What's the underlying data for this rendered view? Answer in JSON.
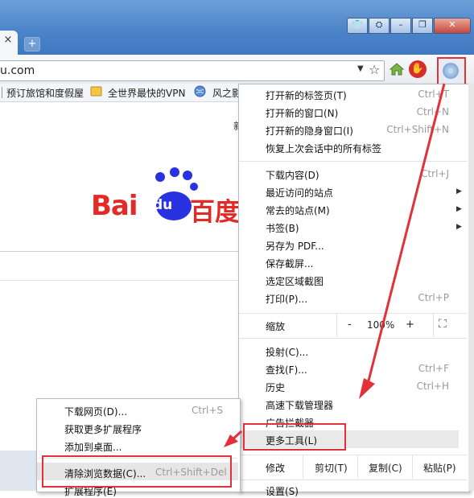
{
  "browser": {
    "tab_close": "×",
    "new_tab": "+",
    "url": "u.com",
    "window_buttons": [
      "👕",
      "⛭",
      "–",
      "❐",
      "✕"
    ]
  },
  "bookmarks": [
    {
      "label": "预订旅馆和度假屋"
    },
    {
      "label": "全世界最快的VPN"
    },
    {
      "label": "风之影"
    }
  ],
  "page": {
    "logo_text": "Bai",
    "logo_du": "du",
    "logo_cn": "百度",
    "side_char": "新"
  },
  "menu": {
    "items": [
      {
        "label": "打开新的标签页(T)",
        "shortcut": "Ctrl+T"
      },
      {
        "label": "打开新的窗口(N)",
        "shortcut": "Ctrl+N"
      },
      {
        "label": "打开新的隐身窗口(I)",
        "shortcut": "Ctrl+Shift+N"
      },
      {
        "label": "恢复上次会话中的所有标签",
        "shortcut": ""
      },
      {
        "label": "下载内容(D)",
        "shortcut": "Ctrl+J"
      },
      {
        "label": "最近访问的站点",
        "shortcut": ""
      },
      {
        "label": "常去的站点(M)",
        "shortcut": ""
      },
      {
        "label": "书签(B)",
        "shortcut": ""
      },
      {
        "label": "另存为 PDF...",
        "shortcut": ""
      },
      {
        "label": "保存截屏...",
        "shortcut": ""
      },
      {
        "label": "选定区域截图",
        "shortcut": ""
      },
      {
        "label": "打印(P)...",
        "shortcut": "Ctrl+P"
      },
      {
        "label": "投射(C)...",
        "shortcut": ""
      },
      {
        "label": "查找(F)...",
        "shortcut": "Ctrl+F"
      },
      {
        "label": "历史",
        "shortcut": "Ctrl+H"
      },
      {
        "label": "高速下载管理器",
        "shortcut": ""
      },
      {
        "label": "广告拦截器",
        "shortcut": ""
      },
      {
        "label": "更多工具(L)",
        "shortcut": ""
      }
    ],
    "zoom": {
      "label": "缩放",
      "minus": "-",
      "value": "100%",
      "plus": "+",
      "fullscreen": "⛶"
    },
    "edit": {
      "label": "修改",
      "cut": "剪切(T)",
      "copy": "复制(C)",
      "paste": "粘贴(P)"
    },
    "settings": "设置(S)"
  },
  "submenu": {
    "items": [
      {
        "label": "下载网页(D)...",
        "shortcut": "Ctrl+S"
      },
      {
        "label": "获取更多扩展程序",
        "shortcut": ""
      },
      {
        "label": "添加到桌面...",
        "shortcut": ""
      },
      {
        "label": "清除浏览数据(C)...",
        "shortcut": "Ctrl+Shift+Del"
      },
      {
        "label": "扩展程序(E)",
        "shortcut": ""
      }
    ]
  },
  "colors": {
    "annotation_red": "#e3313a",
    "baidu_red": "#e32a26",
    "baidu_blue": "#2932e1",
    "titlebar_blue": "#4a83c8"
  },
  "icons": [
    "star-icon",
    "home-icon",
    "stop-icon",
    "menu-icon",
    "dropdown-icon",
    "chevron-right-icon"
  ]
}
